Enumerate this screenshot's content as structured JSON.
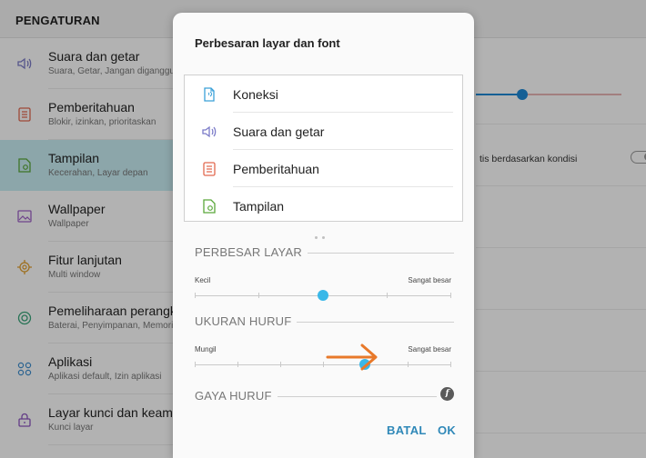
{
  "header": {
    "title": "PENGATURAN"
  },
  "settings_list": [
    {
      "title": "Suara dan getar",
      "subtitle": "Suara, Getar, Jangan diganggu",
      "icon": "volume-icon",
      "selected": false
    },
    {
      "title": "Pemberitahuan",
      "subtitle": "Blokir, izinkan, prioritaskan",
      "icon": "notification-icon",
      "selected": false
    },
    {
      "title": "Tampilan",
      "subtitle": "Kecerahan, Layar depan",
      "icon": "display-icon",
      "selected": true
    },
    {
      "title": "Wallpaper",
      "subtitle": "Wallpaper",
      "icon": "wallpaper-icon",
      "selected": false
    },
    {
      "title": "Fitur lanjutan",
      "subtitle": "Multi window",
      "icon": "advanced-features-icon",
      "selected": false
    },
    {
      "title": "Pemeliharaan perangkat",
      "subtitle": "Baterai, Penyimpanan, Memori",
      "icon": "device-maintenance-icon",
      "selected": false
    },
    {
      "title": "Aplikasi",
      "subtitle": "Aplikasi default, Izin aplikasi",
      "icon": "apps-icon",
      "selected": false
    },
    {
      "title": "Layar kunci dan keamanan",
      "subtitle": "Kunci layar",
      "icon": "lock-icon",
      "selected": false
    }
  ],
  "right_panel": {
    "auto_brightness_text": "tis berdasarkan kondisi",
    "auto_brightness_toggle_on": false,
    "brightness_level": 0.3
  },
  "dialog": {
    "title": "Perbesaran layar dan font",
    "preview_items": [
      {
        "label": "Koneksi",
        "icon": "connections-icon"
      },
      {
        "label": "Suara dan getar",
        "icon": "volume-icon"
      },
      {
        "label": "Pemberitahuan",
        "icon": "notification-icon"
      },
      {
        "label": "Tampilan",
        "icon": "display-icon"
      }
    ],
    "screen_zoom": {
      "section_title": "PERBESAR LAYAR",
      "min_label": "Kecil",
      "max_label": "Sangat besar",
      "steps": 5,
      "selected_step": 2
    },
    "font_size": {
      "section_title": "UKURAN HURUF",
      "min_label": "Mungil",
      "max_label": "Sangat besar",
      "steps": 7,
      "selected_step": 4
    },
    "font_style": {
      "section_title": "GAYA HURUF",
      "info_icon": "font-info-icon",
      "info_glyph": "f"
    },
    "buttons": {
      "cancel": "BATAL",
      "ok": "OK"
    }
  },
  "annotation": {
    "icon": "orange-arrow-icon",
    "color": "#e8792a"
  },
  "colors": {
    "accent": "#3ab8e8",
    "button_text": "#2f88b8",
    "selected_row": "#c9eef4"
  }
}
